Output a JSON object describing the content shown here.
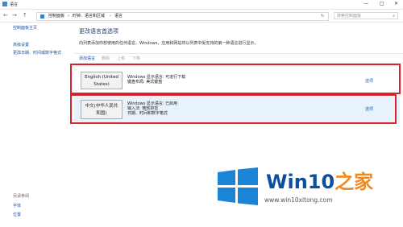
{
  "window": {
    "title": "语言",
    "controls": [
      "—",
      "□",
      "✕"
    ]
  },
  "address": {
    "nav": [
      "←",
      "→",
      "↑"
    ],
    "crumbs": [
      "控制面板",
      "›",
      "时钟、语言和区域",
      "›",
      "语言"
    ],
    "refresh": "↻",
    "search_placeholder": "搜索控制面板"
  },
  "sidebar": {
    "links": [
      "控制面板主页",
      "高级设置",
      "更改日期、时间或数字格式"
    ],
    "see_also": "另请参阅",
    "bottom_links": [
      "字体",
      "位置"
    ]
  },
  "main": {
    "heading": "更改语言首选项",
    "description": "向列表添加你想使用的任何语言。Windows、应用和网站将以列表中受支持的第一种语言进行显示。",
    "toolbar": [
      "添加语言",
      "删除",
      "上移",
      "下移"
    ],
    "languages": [
      {
        "name_line1": "English (United",
        "name_line2": "States)",
        "info": [
          "Windows 显示语言: 可进行下载",
          "键盘布局: 美式键盘"
        ],
        "options": "选项"
      },
      {
        "name_line1": "中文(中华人民共",
        "name_line2": "和国)",
        "info": [
          "Windows 显示语言: 已启用",
          "输入法: 微软拼音",
          "日期、时间和数字格式"
        ],
        "options": "选项"
      }
    ]
  },
  "watermark": {
    "brand": "Win10",
    "brand_suffix": "之家",
    "url": "www.win10xitong.com"
  },
  "colors": {
    "link": "#1a4f9c",
    "highlight": "#d9232e",
    "accent": "#1a85d6"
  }
}
